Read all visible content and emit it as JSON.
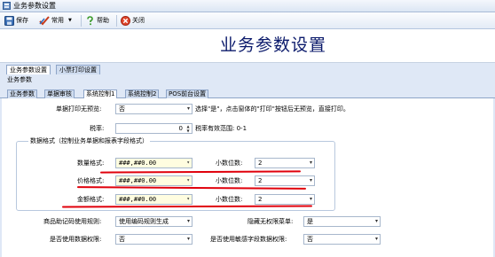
{
  "window": {
    "title": "业务参数设置"
  },
  "toolbar": {
    "save_label": "保存",
    "common_label": "常用",
    "help_label": "帮助",
    "close_label": "关闭"
  },
  "header": {
    "page_title": "业务参数设置"
  },
  "outer_tabs": [
    {
      "label": "业务参数设置",
      "active": true
    },
    {
      "label": "小票打印设置",
      "active": false
    }
  ],
  "section_title": "业务参数",
  "inner_tabs": [
    {
      "label": "业务参数",
      "active": false
    },
    {
      "label": "单据审核",
      "active": false
    },
    {
      "label": "系统控制1",
      "active": true
    },
    {
      "label": "系统控制2",
      "active": false
    },
    {
      "label": "POS前台设置",
      "active": false
    }
  ],
  "form": {
    "print_preview": {
      "label": "单据打印无预览:",
      "value": "否",
      "hint": "选择\"是\"，点击窗体的\"打印\"按钮后无预览，直接打印。"
    },
    "tax_rate": {
      "label": "税率:",
      "value": "0",
      "hint": "税率有效范围: 0-1"
    },
    "format_group": {
      "title": "数据格式（控制业务单据和报表字段格式）",
      "quantity": {
        "label": "数量格式:",
        "value": "###,##0.00",
        "decimals_label": "小数位数:",
        "decimals": "2"
      },
      "price": {
        "label": "价格格式:",
        "value": "###,##0.00",
        "decimals_label": "小数位数:",
        "decimals": "2"
      },
      "amount": {
        "label": "金额格式:",
        "value": "###,##0.00",
        "decimals_label": "小数位数:",
        "decimals": "2"
      }
    },
    "mnemonic_rule": {
      "label": "商品助记码使用规则:",
      "value": "使用编码规则生成"
    },
    "hide_unauth_menu": {
      "label": "隐藏无权限菜单:",
      "value": "是"
    },
    "data_permission": {
      "label": "是否使用数据权限:",
      "value": "否"
    },
    "sensitive_field_permission": {
      "label": "是否使用敏感字段数据权限:",
      "value": "否"
    }
  },
  "colors": {
    "annotation_red": "#e0000b",
    "title_navy": "#0b1a6b"
  }
}
